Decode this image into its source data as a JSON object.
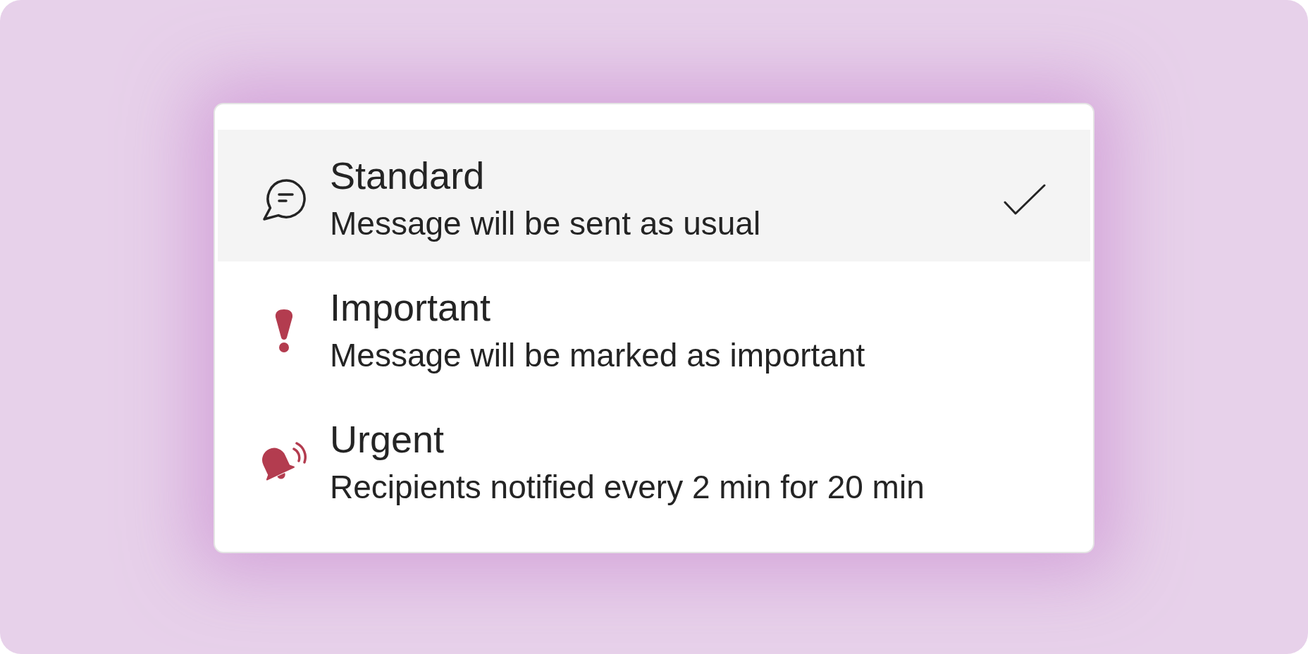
{
  "menu": {
    "items": [
      {
        "kind": "standard",
        "title": "Standard",
        "description": "Message will be sent as usual",
        "selected": true
      },
      {
        "kind": "important",
        "title": "Important",
        "description": "Message will be marked as important",
        "selected": false
      },
      {
        "kind": "urgent",
        "title": "Urgent",
        "description": "Recipients notified every 2 min for 20 min",
        "selected": false
      }
    ]
  }
}
